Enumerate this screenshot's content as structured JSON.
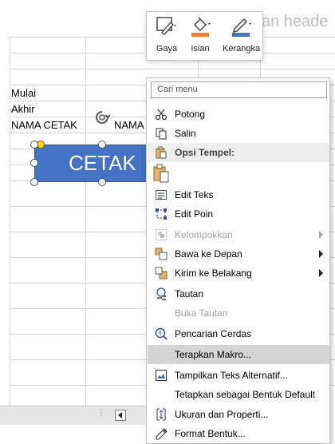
{
  "sheet": {
    "ghost_header": "kan heade",
    "cells": {
      "mulai": "Mulai",
      "akhir": "Akhir",
      "nama_cetak": "NAMA CETAK",
      "nama_partial": "NAMA"
    }
  },
  "shape": {
    "label": "CETAK",
    "fill": "#4472c4"
  },
  "mini_toolbar": {
    "style_label": "Gaya",
    "fill_label": "Isian",
    "outline_label": "Kerangka",
    "fill_color": "#ed7d31",
    "outline_color": "#4472c4"
  },
  "context_menu": {
    "search_placeholder": "Cari menu",
    "items": {
      "cut": "Potong",
      "copy": "Salin",
      "paste_options": "Opsi Tempel:",
      "edit_text": "Edit Teks",
      "edit_points": "Edit Poin",
      "group": "Kelompokkan",
      "bring_front": "Bawa ke Depan",
      "send_back": "Kirim ke Belakang",
      "link": "Tautan",
      "open_link": "Buka Tautan",
      "smart_lookup": "Pencarian Cerdas",
      "assign_macro": "Terapkan Makro...",
      "alt_text": "Tampilkan Teks Alternatif...",
      "set_default": "Tetapkan sebagai Bentuk Default",
      "size_props": "Ukuran dan Properti...",
      "format_shape": "Format Bentuk..."
    }
  },
  "bottom": {
    "dots": "⋮"
  }
}
